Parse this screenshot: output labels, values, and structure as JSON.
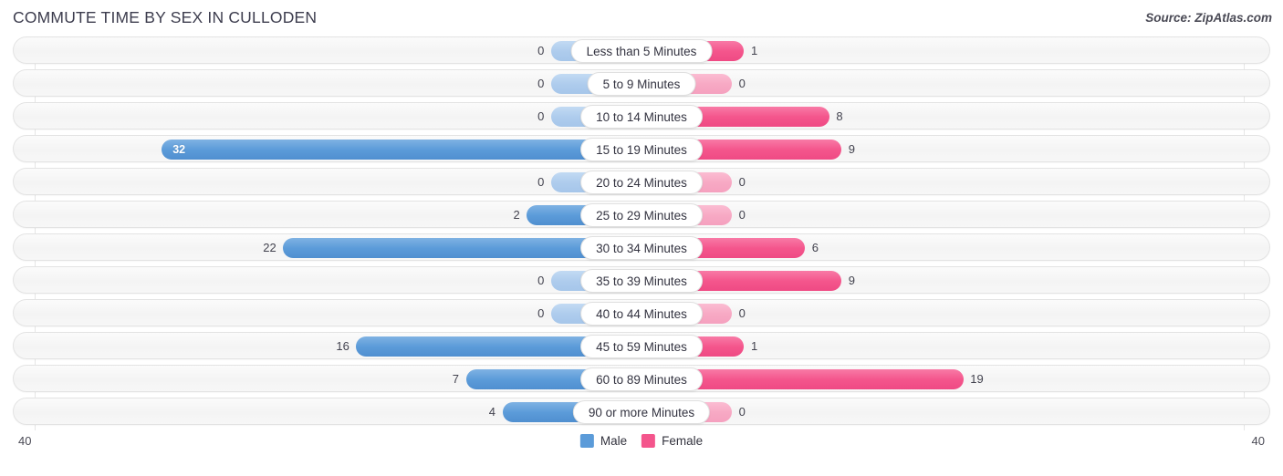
{
  "header": {
    "title": "COMMUTE TIME BY SEX IN CULLODEN",
    "source": "Source: ZipAtlas.com"
  },
  "axis": {
    "left_end": "40",
    "right_end": "40"
  },
  "legend": {
    "items": [
      {
        "label": "Male",
        "color": "#5b9bd9"
      },
      {
        "label": "Female",
        "color": "#f4558c"
      }
    ]
  },
  "colors": {
    "male": "#5b9bd9",
    "male_zero": "#aecced",
    "female": "#f4558c",
    "female_zero": "#f7a9c4",
    "row_track": "#f5f5f5",
    "row_border": "#e3e3e3"
  },
  "chart_data": {
    "type": "bar",
    "title": "COMMUTE TIME BY SEX IN CULLODEN",
    "subtitle": "Source: ZipAtlas.com",
    "orientation": "horizontal",
    "style": "diverging-bidirectional",
    "xlabel": "",
    "ylabel": "",
    "xlim": [
      40,
      40
    ],
    "axis_left_max": 40,
    "axis_right_max": 40,
    "grid": false,
    "legend_position": "bottom-center",
    "categories": [
      "Less than 5 Minutes",
      "5 to 9 Minutes",
      "10 to 14 Minutes",
      "15 to 19 Minutes",
      "20 to 24 Minutes",
      "25 to 29 Minutes",
      "30 to 34 Minutes",
      "35 to 39 Minutes",
      "40 to 44 Minutes",
      "45 to 59 Minutes",
      "60 to 89 Minutes",
      "90 or more Minutes"
    ],
    "series": [
      {
        "name": "Male",
        "values": [
          0,
          0,
          0,
          32,
          0,
          2,
          22,
          0,
          0,
          16,
          7,
          4
        ]
      },
      {
        "name": "Female",
        "values": [
          1,
          0,
          8,
          9,
          0,
          0,
          6,
          9,
          0,
          1,
          19,
          0
        ]
      }
    ]
  },
  "rows": [
    {
      "label": "Less than 5 Minutes",
      "male": 0,
      "male_text": "0",
      "female": 1,
      "female_text": "1"
    },
    {
      "label": "5 to 9 Minutes",
      "male": 0,
      "male_text": "0",
      "female": 0,
      "female_text": "0"
    },
    {
      "label": "10 to 14 Minutes",
      "male": 0,
      "male_text": "0",
      "female": 8,
      "female_text": "8"
    },
    {
      "label": "15 to 19 Minutes",
      "male": 32,
      "male_text": "32",
      "female": 9,
      "female_text": "9"
    },
    {
      "label": "20 to 24 Minutes",
      "male": 0,
      "male_text": "0",
      "female": 0,
      "female_text": "0"
    },
    {
      "label": "25 to 29 Minutes",
      "male": 2,
      "male_text": "2",
      "female": 0,
      "female_text": "0"
    },
    {
      "label": "30 to 34 Minutes",
      "male": 22,
      "male_text": "22",
      "female": 6,
      "female_text": "6"
    },
    {
      "label": "35 to 39 Minutes",
      "male": 0,
      "male_text": "0",
      "female": 9,
      "female_text": "9"
    },
    {
      "label": "40 to 44 Minutes",
      "male": 0,
      "male_text": "0",
      "female": 0,
      "female_text": "0"
    },
    {
      "label": "45 to 59 Minutes",
      "male": 16,
      "male_text": "16",
      "female": 1,
      "female_text": "1"
    },
    {
      "label": "60 to 89 Minutes",
      "male": 7,
      "male_text": "7",
      "female": 19,
      "female_text": "19"
    },
    {
      "label": "90 or more Minutes",
      "male": 4,
      "male_text": "4",
      "female": 0,
      "female_text": "0"
    }
  ]
}
